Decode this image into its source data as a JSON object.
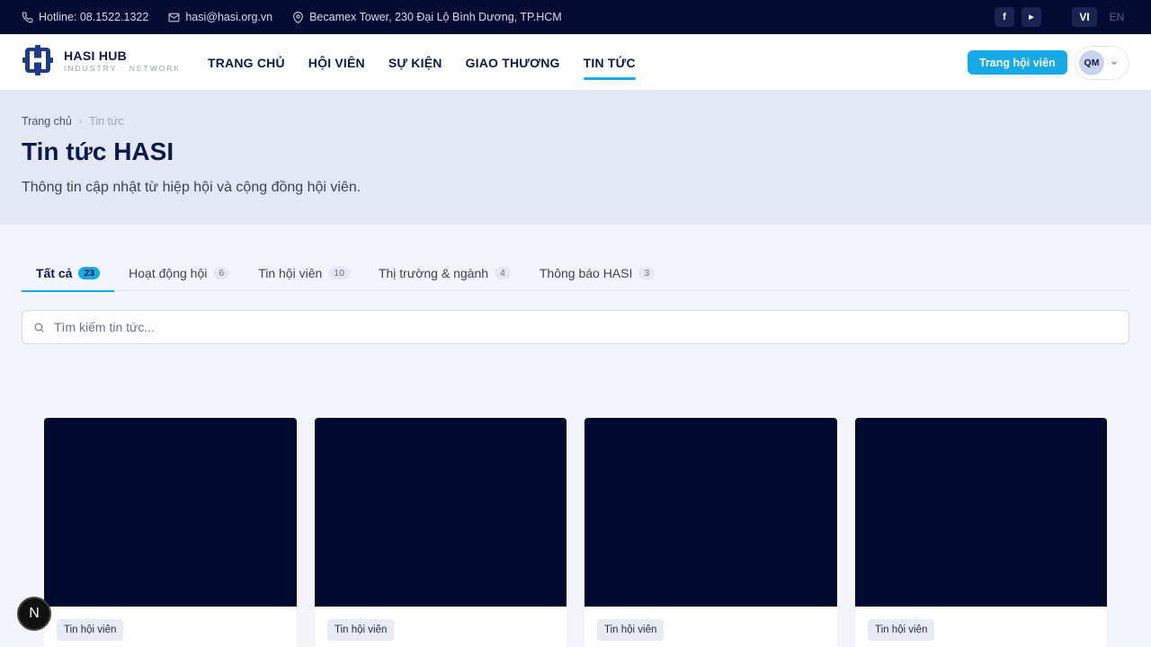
{
  "topbar": {
    "hotline": "Hotline: 08.1522.1322",
    "email": "hasi@hasi.org.vn",
    "address": "Becamex Tower, 230 Đại Lộ Bình Dương, TP.HCM",
    "social": [
      "f",
      "▶"
    ],
    "lang_vi": "VI",
    "lang_en": "EN"
  },
  "nav": {
    "logo_name": "HASI HUB",
    "logo_tag": "INDUSTRY · NETWORK",
    "items": [
      "TRANG CHỦ",
      "HỘI VIÊN",
      "SỰ KIỆN",
      "GIAO THƯƠNG",
      "TIN TỨC"
    ],
    "active_index": 4,
    "member_button": "Trang hội viên",
    "avatar": "QM"
  },
  "hero": {
    "breadcrumb_home": "Trang chủ",
    "breadcrumb_current": "Tin tức",
    "title": "Tin tức HASI",
    "subtitle": "Thông tin cập nhật từ hiệp hội và cộng đồng hội viên."
  },
  "tabs": [
    {
      "label": "Tất cả",
      "count": "23"
    },
    {
      "label": "Hoạt động hội",
      "count": "6"
    },
    {
      "label": "Tin hội viên",
      "count": "10"
    },
    {
      "label": "Thị trường & ngành",
      "count": "4"
    },
    {
      "label": "Thông báo HASI",
      "count": "3"
    }
  ],
  "search": {
    "placeholder": "Tìm kiếm tin tức..."
  },
  "cards": [
    {
      "tag": "Tin hội viên"
    },
    {
      "tag": "Tin hội viên"
    },
    {
      "tag": "Tin hội viên"
    },
    {
      "tag": "Tin hội viên"
    }
  ],
  "fab_label": "N",
  "colors": {
    "topbar_bg": "#030b33",
    "accent": "#16a9e8",
    "brand_navy": "#0b1a4d",
    "card_image": "#000a2e"
  }
}
